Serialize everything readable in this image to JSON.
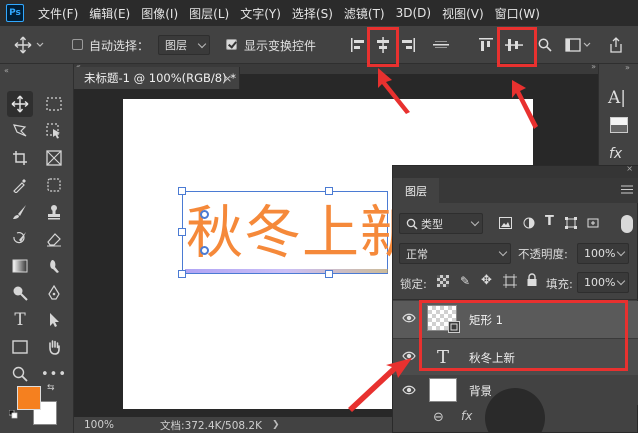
{
  "app": {
    "logo": "Ps"
  },
  "menu": [
    "文件(F)",
    "编辑(E)",
    "图像(I)",
    "图层(L)",
    "文字(Y)",
    "选择(S)",
    "滤镜(T)",
    "3D(D)",
    "视图(V)",
    "窗口(W)"
  ],
  "options": {
    "auto_select_label": "自动选择：",
    "auto_select_value": "图层",
    "show_transform_label": "显示变换控件"
  },
  "document": {
    "tab_title": "未标题-1 @ 100%(RGB/8) *",
    "text_content": "秋冬上新",
    "zoom": "100%",
    "doc_info": "文档:372.4K/508.2K",
    "text_color": "#f5893a"
  },
  "layers_panel": {
    "title": "图层",
    "filter_value": "类型",
    "blend_mode": "正常",
    "opacity_label": "不透明度:",
    "opacity_value": "100%",
    "lock_label": "锁定:",
    "fill_label": "填充:",
    "fill_value": "100%",
    "layers": [
      {
        "name": "矩形 1",
        "type": "shape"
      },
      {
        "name": "秋冬上新",
        "type": "text"
      },
      {
        "name": "背景",
        "type": "background"
      }
    ]
  },
  "colors": {
    "foreground": "#f5801f",
    "background": "#ffffff",
    "highlight": "#e8312f",
    "selection": "#4b7bd3"
  },
  "icons": {
    "align_horizontal_centers": "align-horizontal-centers-icon",
    "align_vertical_centers": "align-vertical-centers-icon"
  }
}
